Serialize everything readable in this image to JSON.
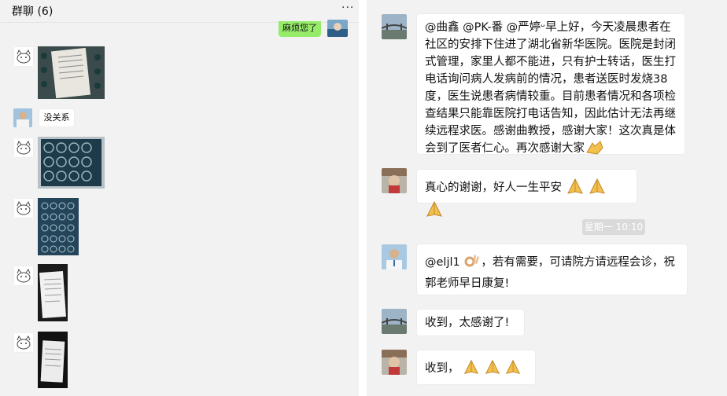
{
  "left_panel": {
    "title": "群聊 (6)",
    "more_icon": "more-icon",
    "messages": [
      {
        "kind": "text-outgoing",
        "text": "麻烦您了"
      },
      {
        "kind": "image",
        "avatar": "cat-avatar"
      },
      {
        "kind": "text",
        "avatar": "doctor-avatar",
        "text": "没关系"
      },
      {
        "kind": "image",
        "avatar": "cat-avatar"
      },
      {
        "kind": "image",
        "avatar": "cat-avatar"
      },
      {
        "kind": "image",
        "avatar": "cat-avatar"
      },
      {
        "kind": "image",
        "avatar": "cat-avatar"
      }
    ]
  },
  "right_panel": {
    "messages": [
      {
        "avatar": "bridge-avatar",
        "text": "@曲鑫 @PK-番 @严婷ᵕ早上好，今天凌晨患者在社区的安排下住进了湖北省新华医院。医院是封闭式管理，家里人都不能进，只有护士转话，医生打电话询问病人发病前的情况，患者送医时发烧38度，医生说患者病情较重。目前患者情况和各项检查结果只能靠医院打电话告知，因此估计无法再继续远程求医。感谢曲教授，感谢大家！这次真是体会到了医者仁心。再次感谢大家"
      },
      {
        "avatar": "person-avatar",
        "text": "真心的谢谢，好人一生平安"
      },
      {
        "timestamp": "星期一 10:10"
      },
      {
        "avatar": "doctor-avatar",
        "text": "@eljl1",
        "text2": "，若有需要，可请院方请远程会诊，祝郭老师早日康复!"
      },
      {
        "avatar": "bridge-avatar",
        "text": "收到，太感谢了!"
      },
      {
        "avatar": "person-avatar",
        "text": "收到，"
      }
    ]
  },
  "colors": {
    "background": "#f2f2f2",
    "outgoing_bubble": "#95ec69",
    "incoming_bubble": "#ffffff",
    "timestamp_bg": "#dadada"
  }
}
